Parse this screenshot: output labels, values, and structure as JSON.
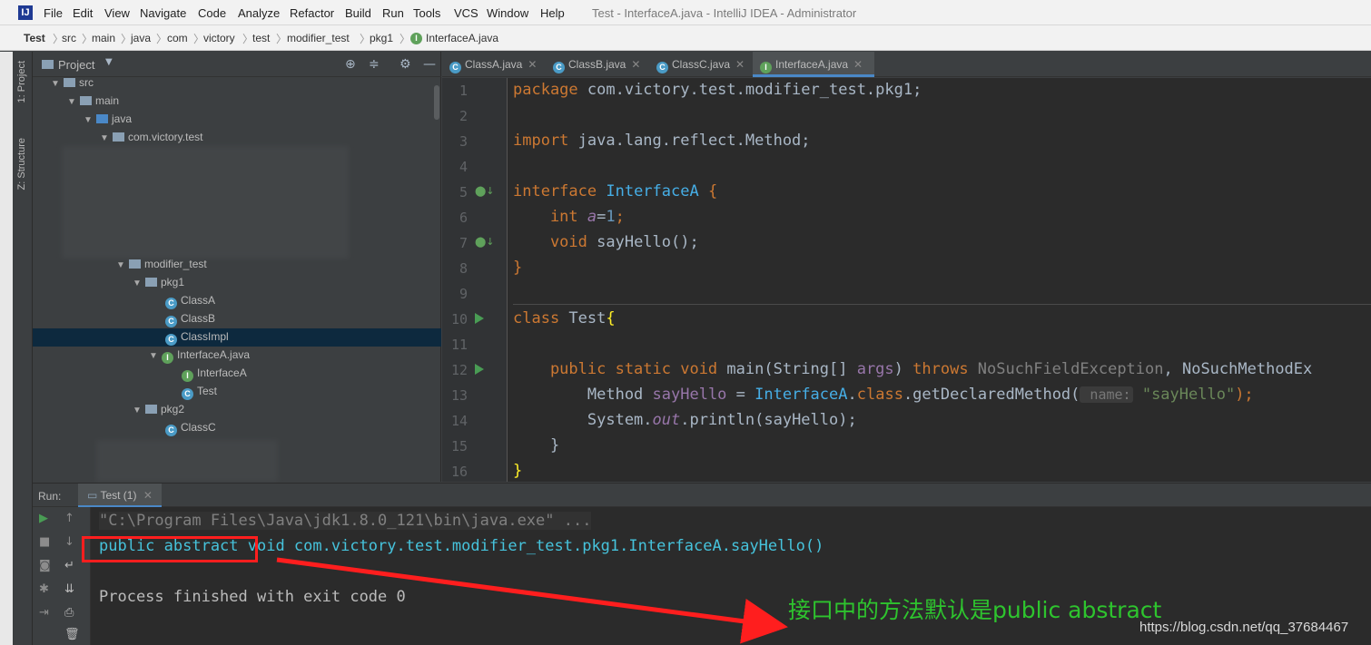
{
  "app": {
    "logo_letter": "IJ",
    "window_title": "Test - InterfaceA.java - IntelliJ IDEA - Administrator",
    "menu": [
      "File",
      "Edit",
      "View",
      "Navigate",
      "Code",
      "Analyze",
      "Refactor",
      "Build",
      "Run",
      "Tools",
      "VCS",
      "Window",
      "Help"
    ]
  },
  "breadcrumb": [
    "Test",
    "src",
    "main",
    "java",
    "com",
    "victory",
    "test",
    "modifier_test",
    "pkg1",
    "InterfaceA.java"
  ],
  "side_tabs": {
    "project": "1: Project",
    "structure": "Z: Structure"
  },
  "project": {
    "title": "Project",
    "tree": {
      "src": "src",
      "main": "main",
      "java": "java",
      "pkg_root": "com.victory.test",
      "modifier_test": "modifier_test",
      "pkg1": "pkg1",
      "classA": "ClassA",
      "classB": "ClassB",
      "classImpl": "ClassImpl",
      "interfaceA_file": "InterfaceA.java",
      "interfaceA": "InterfaceA",
      "test": "Test",
      "pkg2": "pkg2",
      "classC": "ClassC"
    }
  },
  "editor": {
    "tabs": [
      "ClassA.java",
      "ClassB.java",
      "ClassC.java",
      "InterfaceA.java"
    ],
    "active_tab": "InterfaceA.java",
    "line_numbers": [
      "1",
      "2",
      "3",
      "4",
      "5",
      "6",
      "7",
      "8",
      "9",
      "10",
      "11",
      "12",
      "13",
      "14",
      "15",
      "16"
    ],
    "code": {
      "l1_kw": "package",
      "l1_rest": " com.victory.test.modifier_test.pkg1;",
      "l3_kw": "import",
      "l3_rest": " java.lang.reflect.Method;",
      "l5_kw": "interface",
      "l5_name": " InterfaceA",
      "l5_brace": " {",
      "l6_kw": "    int",
      "l6_var": " a",
      "l6_eq": "=",
      "l6_num": "1",
      "l6_end": ";",
      "l7_kw": "    void",
      "l7_rest": " sayHello();",
      "l8": "}",
      "l10_kw": "class",
      "l10_name": " Test",
      "l10_brace": "{",
      "l12_mods": "    public static void",
      "l12_main": " main(String[]",
      "l12_args": " args",
      "l12_close": ")",
      "l12_throws": " throws",
      "l12_exc1": " NoSuchFieldException",
      "l12_exc2": ", NoSuchMethodEx",
      "l13_a": "        Method",
      "l13_var": " sayHello",
      "l13_b": " =",
      "l13_iname": " InterfaceA",
      "l13_c": ".",
      "l13_kw": "class",
      "l13_d": ".getDeclaredMethod(",
      "l13_hint": " name:",
      "l13_str": " \"sayHello\"",
      "l13_end": ");",
      "l14_a": "        System.",
      "l14_out": "out",
      "l14_b": ".println(sayHello);",
      "l15": "    }",
      "l16": "}"
    }
  },
  "run": {
    "label": "Run:",
    "tab": "Test (1)",
    "console": {
      "cmd": "\"C:\\Program Files\\Java\\jdk1.8.0_121\\bin\\java.exe\" ...",
      "output": "public abstract void com.victory.test.modifier_test.pkg1.InterfaceA.sayHello()",
      "finished": "Process finished with exit code 0"
    }
  },
  "annotation": {
    "text": "接口中的方法默认是public abstract",
    "color": "#2ec42e",
    "highlight_color": "#ff1e1e"
  },
  "watermark": "https://blog.csdn.net/qq_37684467"
}
